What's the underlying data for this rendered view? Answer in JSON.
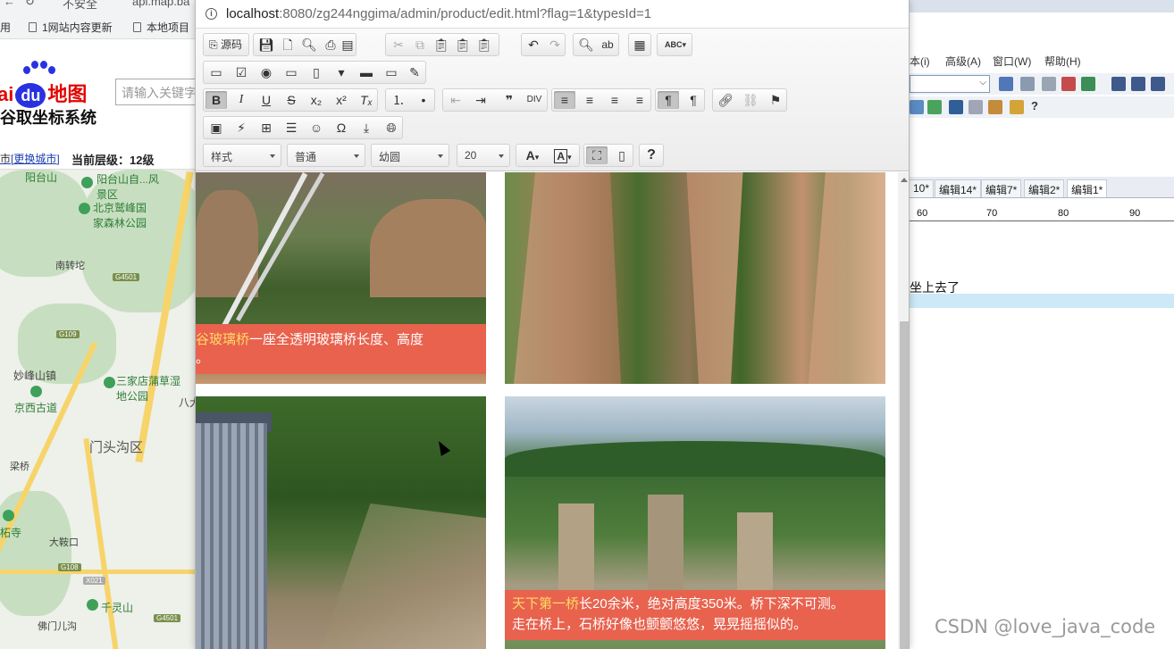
{
  "background_browser": {
    "tab_fragment_1": "不安全",
    "tab_fragment_2": "api.map.ba",
    "bookmark_prefix": "用",
    "bookmarks": [
      "1网站内容更新",
      "本地项目"
    ]
  },
  "baidu_map": {
    "logo_left": "ai",
    "logo_du": "du",
    "logo_right": "地图",
    "subtitle": "谷取坐标系统",
    "search_placeholder": "请输入关键字",
    "change_city": "更换城市",
    "city_prefix": "市",
    "current_level": "当前层级：12级",
    "places": [
      "阳台山",
      "阳台山自...风景区",
      "北京鹫峰国家森林公园",
      "南转坨",
      "妙峰山镇",
      "三家店蒲草湿地公园",
      "京西古道",
      "门头沟区",
      "梁桥",
      "大鞍口",
      "千灵山",
      "佛门儿沟",
      "柘寺",
      "八大"
    ],
    "road_tags": [
      "G4501",
      "G109",
      "G108",
      "X021",
      "G4501"
    ]
  },
  "right_app": {
    "menu": [
      "本(i)",
      "高级(A)",
      "窗口(W)",
      "帮助(H)"
    ],
    "tabs": [
      "10*",
      "编辑14*",
      "编辑7*",
      "编辑2*",
      "编辑1*"
    ],
    "ruler": [
      "60",
      "70",
      "80",
      "90"
    ],
    "text_line": "坐上去了"
  },
  "popup": {
    "url_host": "localhost",
    "url_path": ":8080/zg244nggima/admin/product/edit.html?flag=1&typesId=1",
    "toolbar": {
      "source_label": "源码",
      "style_combo": "样式",
      "format_combo": "普通",
      "font_combo": "幼圆",
      "size_combo": "20",
      "help_label": "?"
    },
    "content": {
      "caption1_highlight": "谷玻璃桥",
      "caption1_text": "一座全透明玻璃桥长度、高度",
      "caption1_line2": "。",
      "caption2_highlight": "天下第一桥",
      "caption2_text": "长20余米，绝对高度350米。桥下深不可测。",
      "caption2_line2": "走在桥上，石桥好像也颤颤悠悠，晃晃摇摇似的。"
    }
  },
  "watermark": "CSDN @love_java_code"
}
